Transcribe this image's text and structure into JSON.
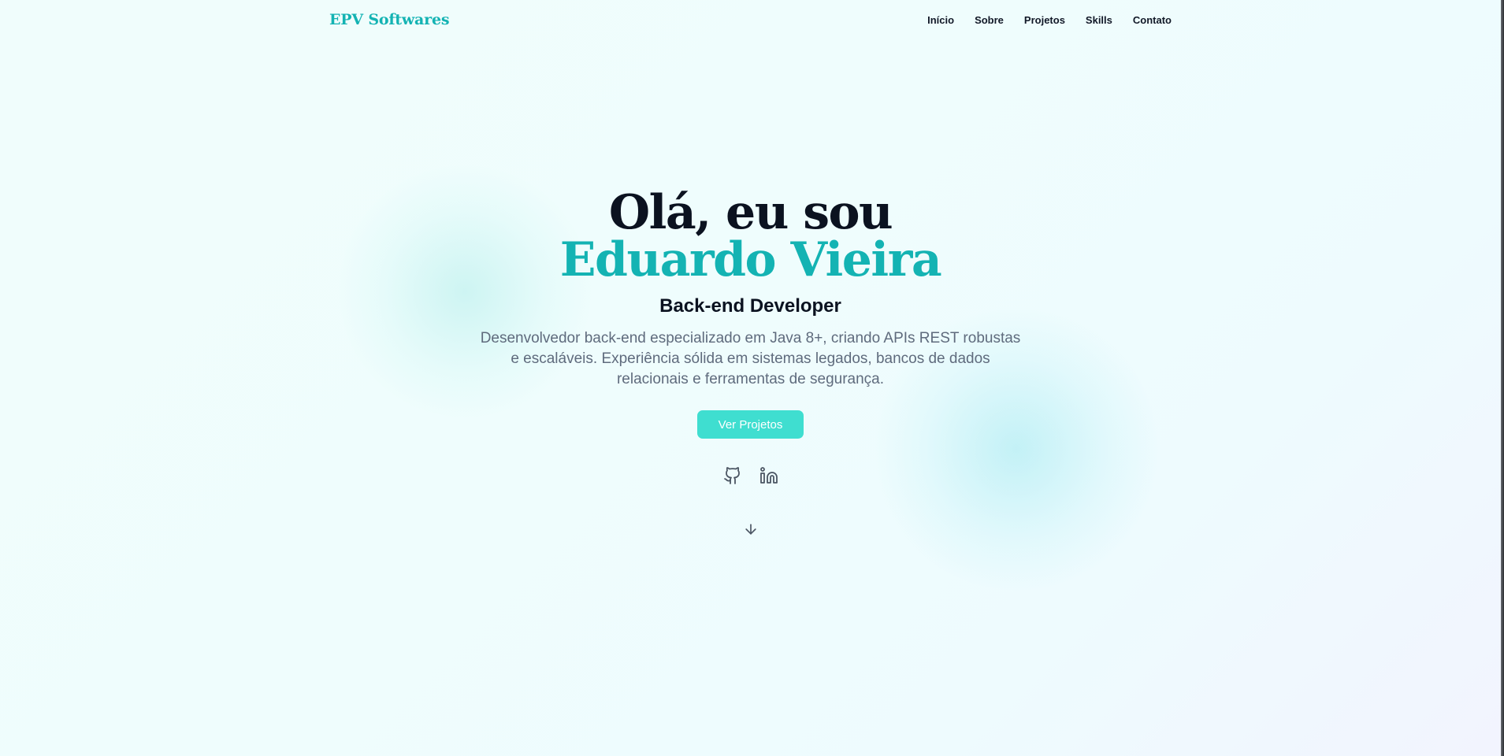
{
  "nav": {
    "brand": "EPV Softwares",
    "links": [
      "Início",
      "Sobre",
      "Projetos",
      "Skills",
      "Contato"
    ]
  },
  "hero": {
    "greeting": "Olá, eu sou",
    "name": "Eduardo Vieira",
    "role": "Back-end Developer",
    "description": "Desenvolvedor back-end especializado em Java 8+, criando APIs REST robustas e escaláveis. Experiência sólida em sistemas legados, bancos de dados relacionais e ferramentas de segurança.",
    "cta_label": "Ver Projetos",
    "socials": [
      "github-icon",
      "linkedin-icon"
    ],
    "scroll_icon": "arrow-down-icon"
  },
  "colors": {
    "accent": "#14b3b3",
    "button": "#3fded0",
    "text": "#0b1220",
    "muted": "#5f6b7d"
  }
}
